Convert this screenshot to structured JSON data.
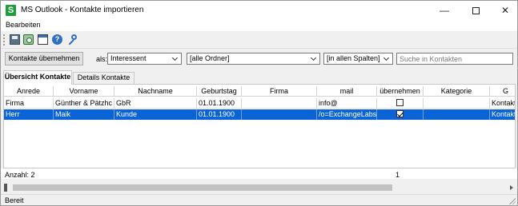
{
  "window": {
    "title": "MS Outlook - Kontakte importieren",
    "app_icon_glyph": "S",
    "app_icon_color": "#1f9d3a",
    "controls": {
      "minimize": "—",
      "close": "✕"
    }
  },
  "menu": {
    "items": [
      {
        "label": "Bearbeiten"
      }
    ]
  },
  "toolbar": {
    "icons": [
      "save-icon",
      "address-book-icon",
      "terminal-icon",
      "help-icon",
      "key-icon"
    ],
    "help_glyph": "?"
  },
  "filters": {
    "take_button": "Kontakte übernehmen",
    "as_label": "als:",
    "type_value": "Interessent",
    "folder_value": "[alle Ordner]",
    "column_value": "[in allen Spalten]",
    "search_placeholder": "Suche in Kontakten"
  },
  "tabs": [
    {
      "label": "Übersicht Kontakte",
      "active": true
    },
    {
      "label": "Details Kontakte",
      "active": false
    }
  ],
  "grid": {
    "columns": [
      "Anrede",
      "Vorname",
      "Nachname",
      "Geburtstag",
      "Firma",
      "mail",
      "übernehmen",
      "Kategorie",
      "G"
    ],
    "rows": [
      {
        "anrede": "Firma",
        "vorname": "Günther & Pätzhc",
        "nachname": "GbR",
        "geburtstag": "01.01.1900",
        "firma": "",
        "mail": "info@",
        "uebernehmen": false,
        "kategorie": "",
        "extra": "Kontakt"
      },
      {
        "anrede": "Herr",
        "vorname": "Maik",
        "nachname": "Kunde",
        "geburtstag": "01.01.1900",
        "firma": "",
        "mail": "/o=ExchangeLabs",
        "uebernehmen": true,
        "kategorie": "",
        "extra": "Kontakt"
      }
    ],
    "selected_row_color": "#0a64d6"
  },
  "footer": {
    "count_text": "Anzahl: 2",
    "selected_count": "1"
  },
  "status": {
    "text": "Bereit"
  }
}
